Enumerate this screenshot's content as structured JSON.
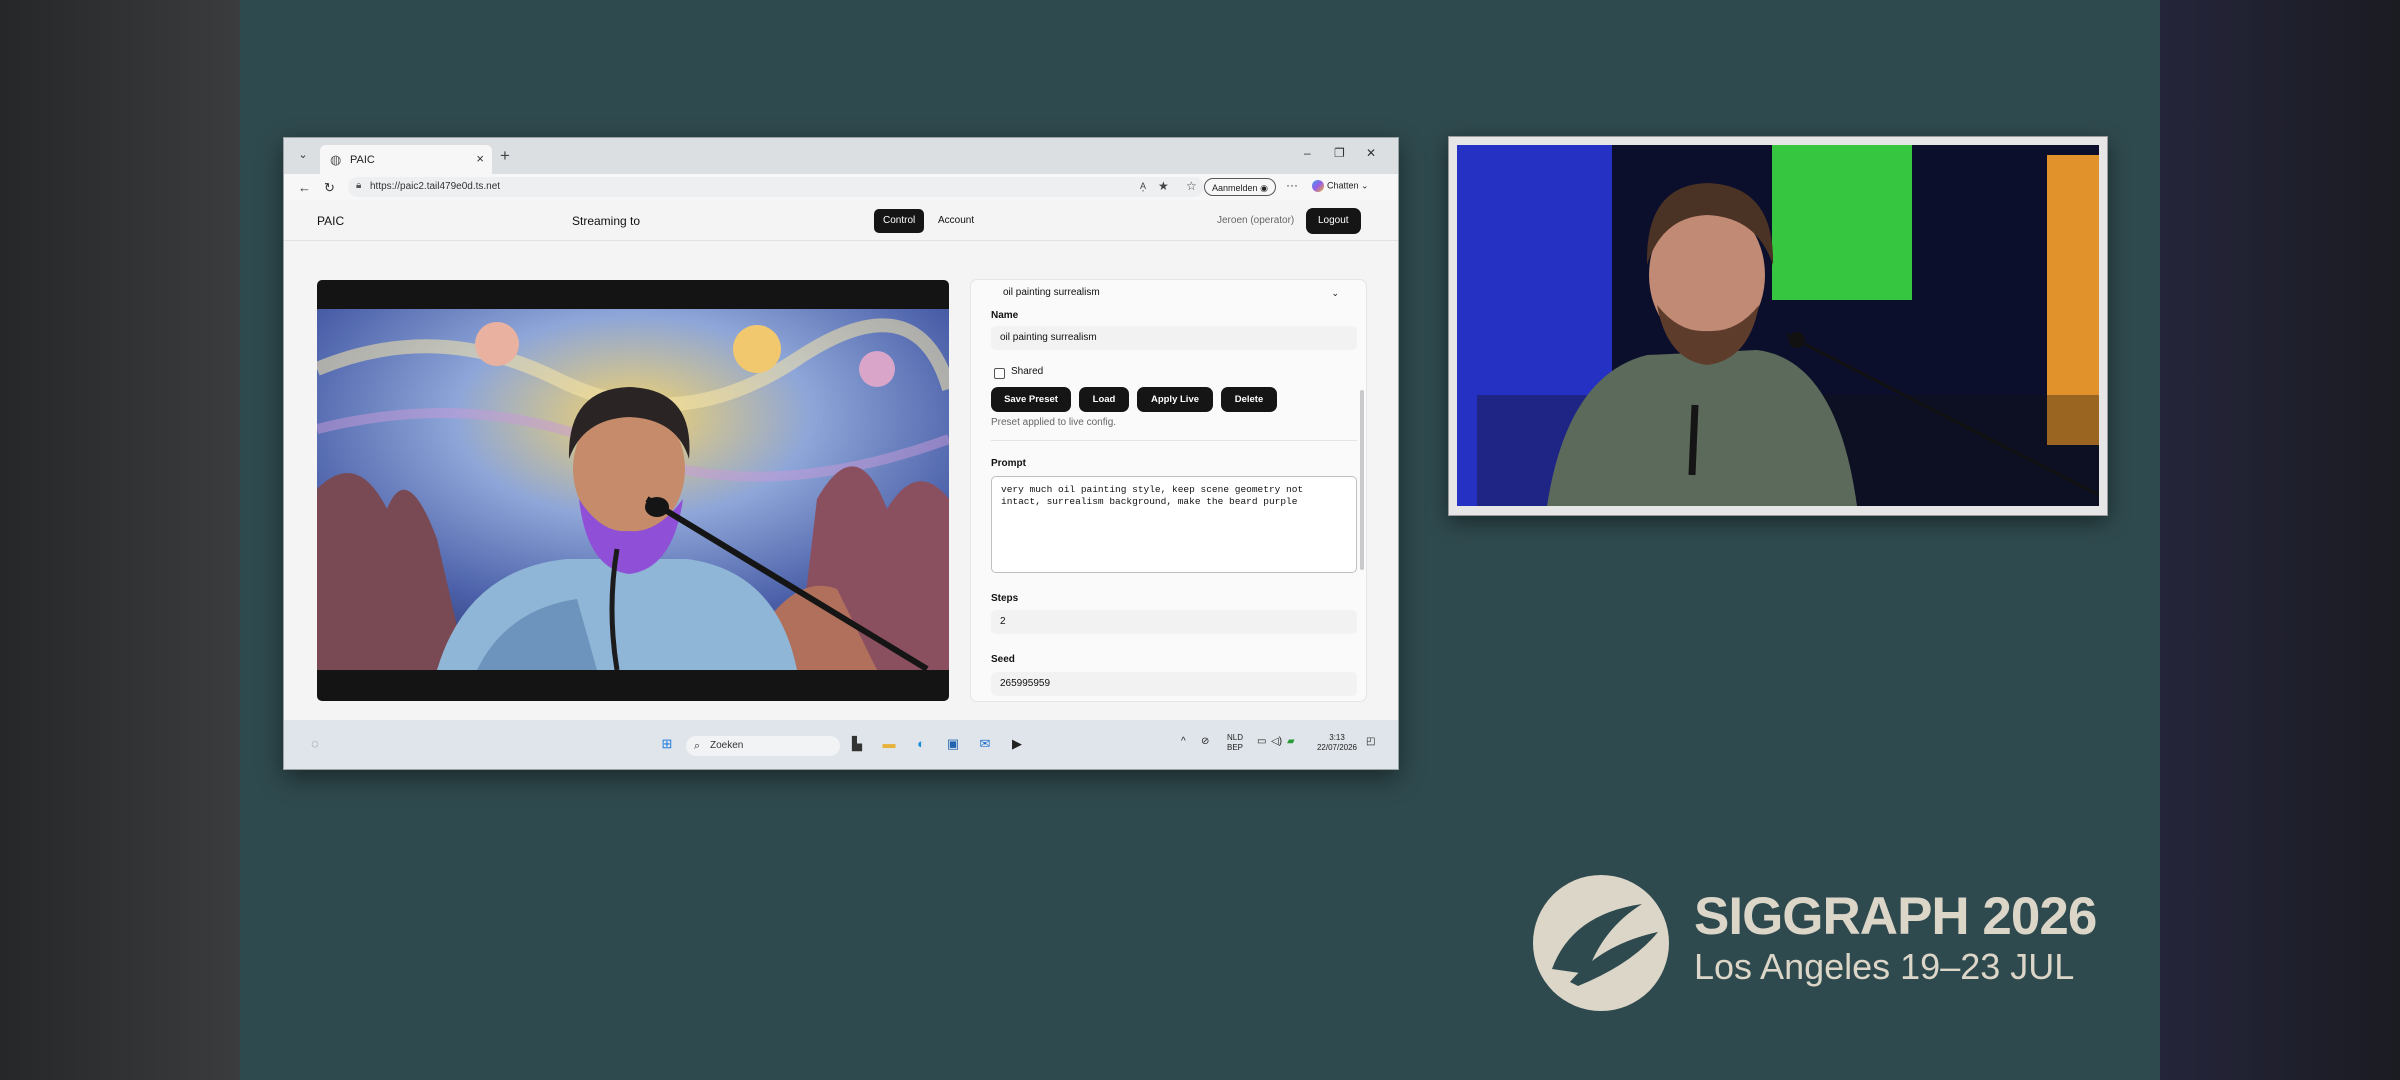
{
  "browser": {
    "tab_title": "PAIC",
    "url": "https://paic2.tail479e0d.ts.net",
    "signin_label": "Aanmelden",
    "chat_label": "Chatten"
  },
  "app": {
    "brand": "PAIC",
    "streaming_label": "Streaming to",
    "nav": {
      "control": "Control",
      "account": "Account"
    },
    "user": "Jeroen (operator)",
    "logout": "Logout"
  },
  "panel": {
    "preset_selected": "oil painting surrealism",
    "name_label": "Name",
    "name_value": "oil painting surrealism",
    "shared_label": "Shared",
    "buttons": {
      "save": "Save Preset",
      "load": "Load",
      "apply": "Apply Live",
      "delete": "Delete"
    },
    "status": "Preset applied to live config.",
    "prompt_label": "Prompt",
    "prompt_value": "very much oil painting style, keep scene geometry not intact, surrealism background, make the beard purple",
    "steps_label": "Steps",
    "steps_value": "2",
    "seed_label": "Seed",
    "seed_value": "265995959"
  },
  "taskbar": {
    "search_placeholder": "Zoeken",
    "lang": "NLD",
    "kb": "BEP",
    "time": "3:13",
    "date": "22/07/2026"
  },
  "event": {
    "title": "SIGGRAPH 2026",
    "subtitle": "Los Angeles  19–23 JUL"
  },
  "colors": {
    "stage": "#2f4a4e",
    "accent_dark": "#151515",
    "logo": "#dcd6c8"
  }
}
